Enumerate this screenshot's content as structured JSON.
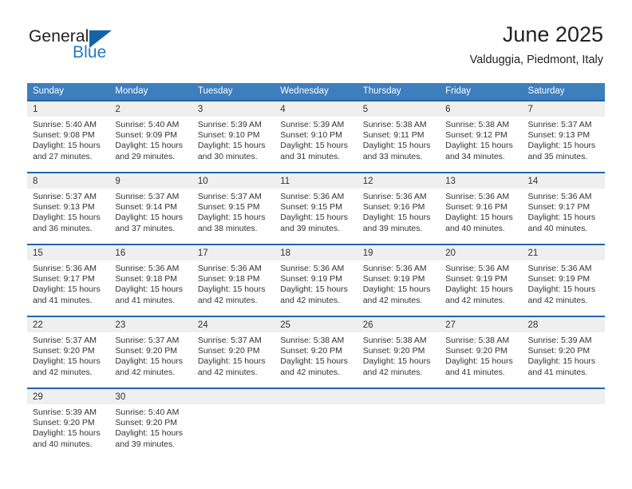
{
  "brand": {
    "name_part1": "General",
    "name_part2": "Blue"
  },
  "header": {
    "title": "June 2025",
    "subtitle": "Valduggia, Piedmont, Italy"
  },
  "colors": {
    "header_blue": "#3d7ebd",
    "separator_blue": "#2565a8",
    "day_band_gray": "#efefef",
    "brand_blue": "#1f7ac4",
    "text": "#333333"
  },
  "weekdays": [
    "Sunday",
    "Monday",
    "Tuesday",
    "Wednesday",
    "Thursday",
    "Friday",
    "Saturday"
  ],
  "weeks": [
    [
      {
        "day": "1",
        "sunrise": "Sunrise: 5:40 AM",
        "sunset": "Sunset: 9:08 PM",
        "daylight1": "Daylight: 15 hours",
        "daylight2": "and 27 minutes."
      },
      {
        "day": "2",
        "sunrise": "Sunrise: 5:40 AM",
        "sunset": "Sunset: 9:09 PM",
        "daylight1": "Daylight: 15 hours",
        "daylight2": "and 29 minutes."
      },
      {
        "day": "3",
        "sunrise": "Sunrise: 5:39 AM",
        "sunset": "Sunset: 9:10 PM",
        "daylight1": "Daylight: 15 hours",
        "daylight2": "and 30 minutes."
      },
      {
        "day": "4",
        "sunrise": "Sunrise: 5:39 AM",
        "sunset": "Sunset: 9:10 PM",
        "daylight1": "Daylight: 15 hours",
        "daylight2": "and 31 minutes."
      },
      {
        "day": "5",
        "sunrise": "Sunrise: 5:38 AM",
        "sunset": "Sunset: 9:11 PM",
        "daylight1": "Daylight: 15 hours",
        "daylight2": "and 33 minutes."
      },
      {
        "day": "6",
        "sunrise": "Sunrise: 5:38 AM",
        "sunset": "Sunset: 9:12 PM",
        "daylight1": "Daylight: 15 hours",
        "daylight2": "and 34 minutes."
      },
      {
        "day": "7",
        "sunrise": "Sunrise: 5:37 AM",
        "sunset": "Sunset: 9:13 PM",
        "daylight1": "Daylight: 15 hours",
        "daylight2": "and 35 minutes."
      }
    ],
    [
      {
        "day": "8",
        "sunrise": "Sunrise: 5:37 AM",
        "sunset": "Sunset: 9:13 PM",
        "daylight1": "Daylight: 15 hours",
        "daylight2": "and 36 minutes."
      },
      {
        "day": "9",
        "sunrise": "Sunrise: 5:37 AM",
        "sunset": "Sunset: 9:14 PM",
        "daylight1": "Daylight: 15 hours",
        "daylight2": "and 37 minutes."
      },
      {
        "day": "10",
        "sunrise": "Sunrise: 5:37 AM",
        "sunset": "Sunset: 9:15 PM",
        "daylight1": "Daylight: 15 hours",
        "daylight2": "and 38 minutes."
      },
      {
        "day": "11",
        "sunrise": "Sunrise: 5:36 AM",
        "sunset": "Sunset: 9:15 PM",
        "daylight1": "Daylight: 15 hours",
        "daylight2": "and 39 minutes."
      },
      {
        "day": "12",
        "sunrise": "Sunrise: 5:36 AM",
        "sunset": "Sunset: 9:16 PM",
        "daylight1": "Daylight: 15 hours",
        "daylight2": "and 39 minutes."
      },
      {
        "day": "13",
        "sunrise": "Sunrise: 5:36 AM",
        "sunset": "Sunset: 9:16 PM",
        "daylight1": "Daylight: 15 hours",
        "daylight2": "and 40 minutes."
      },
      {
        "day": "14",
        "sunrise": "Sunrise: 5:36 AM",
        "sunset": "Sunset: 9:17 PM",
        "daylight1": "Daylight: 15 hours",
        "daylight2": "and 40 minutes."
      }
    ],
    [
      {
        "day": "15",
        "sunrise": "Sunrise: 5:36 AM",
        "sunset": "Sunset: 9:17 PM",
        "daylight1": "Daylight: 15 hours",
        "daylight2": "and 41 minutes."
      },
      {
        "day": "16",
        "sunrise": "Sunrise: 5:36 AM",
        "sunset": "Sunset: 9:18 PM",
        "daylight1": "Daylight: 15 hours",
        "daylight2": "and 41 minutes."
      },
      {
        "day": "17",
        "sunrise": "Sunrise: 5:36 AM",
        "sunset": "Sunset: 9:18 PM",
        "daylight1": "Daylight: 15 hours",
        "daylight2": "and 42 minutes."
      },
      {
        "day": "18",
        "sunrise": "Sunrise: 5:36 AM",
        "sunset": "Sunset: 9:19 PM",
        "daylight1": "Daylight: 15 hours",
        "daylight2": "and 42 minutes."
      },
      {
        "day": "19",
        "sunrise": "Sunrise: 5:36 AM",
        "sunset": "Sunset: 9:19 PM",
        "daylight1": "Daylight: 15 hours",
        "daylight2": "and 42 minutes."
      },
      {
        "day": "20",
        "sunrise": "Sunrise: 5:36 AM",
        "sunset": "Sunset: 9:19 PM",
        "daylight1": "Daylight: 15 hours",
        "daylight2": "and 42 minutes."
      },
      {
        "day": "21",
        "sunrise": "Sunrise: 5:36 AM",
        "sunset": "Sunset: 9:19 PM",
        "daylight1": "Daylight: 15 hours",
        "daylight2": "and 42 minutes."
      }
    ],
    [
      {
        "day": "22",
        "sunrise": "Sunrise: 5:37 AM",
        "sunset": "Sunset: 9:20 PM",
        "daylight1": "Daylight: 15 hours",
        "daylight2": "and 42 minutes."
      },
      {
        "day": "23",
        "sunrise": "Sunrise: 5:37 AM",
        "sunset": "Sunset: 9:20 PM",
        "daylight1": "Daylight: 15 hours",
        "daylight2": "and 42 minutes."
      },
      {
        "day": "24",
        "sunrise": "Sunrise: 5:37 AM",
        "sunset": "Sunset: 9:20 PM",
        "daylight1": "Daylight: 15 hours",
        "daylight2": "and 42 minutes."
      },
      {
        "day": "25",
        "sunrise": "Sunrise: 5:38 AM",
        "sunset": "Sunset: 9:20 PM",
        "daylight1": "Daylight: 15 hours",
        "daylight2": "and 42 minutes."
      },
      {
        "day": "26",
        "sunrise": "Sunrise: 5:38 AM",
        "sunset": "Sunset: 9:20 PM",
        "daylight1": "Daylight: 15 hours",
        "daylight2": "and 42 minutes."
      },
      {
        "day": "27",
        "sunrise": "Sunrise: 5:38 AM",
        "sunset": "Sunset: 9:20 PM",
        "daylight1": "Daylight: 15 hours",
        "daylight2": "and 41 minutes."
      },
      {
        "day": "28",
        "sunrise": "Sunrise: 5:39 AM",
        "sunset": "Sunset: 9:20 PM",
        "daylight1": "Daylight: 15 hours",
        "daylight2": "and 41 minutes."
      }
    ],
    [
      {
        "day": "29",
        "sunrise": "Sunrise: 5:39 AM",
        "sunset": "Sunset: 9:20 PM",
        "daylight1": "Daylight: 15 hours",
        "daylight2": "and 40 minutes."
      },
      {
        "day": "30",
        "sunrise": "Sunrise: 5:40 AM",
        "sunset": "Sunset: 9:20 PM",
        "daylight1": "Daylight: 15 hours",
        "daylight2": "and 39 minutes."
      },
      {
        "day": "",
        "sunrise": "",
        "sunset": "",
        "daylight1": "",
        "daylight2": ""
      },
      {
        "day": "",
        "sunrise": "",
        "sunset": "",
        "daylight1": "",
        "daylight2": ""
      },
      {
        "day": "",
        "sunrise": "",
        "sunset": "",
        "daylight1": "",
        "daylight2": ""
      },
      {
        "day": "",
        "sunrise": "",
        "sunset": "",
        "daylight1": "",
        "daylight2": ""
      },
      {
        "day": "",
        "sunrise": "",
        "sunset": "",
        "daylight1": "",
        "daylight2": ""
      }
    ]
  ]
}
